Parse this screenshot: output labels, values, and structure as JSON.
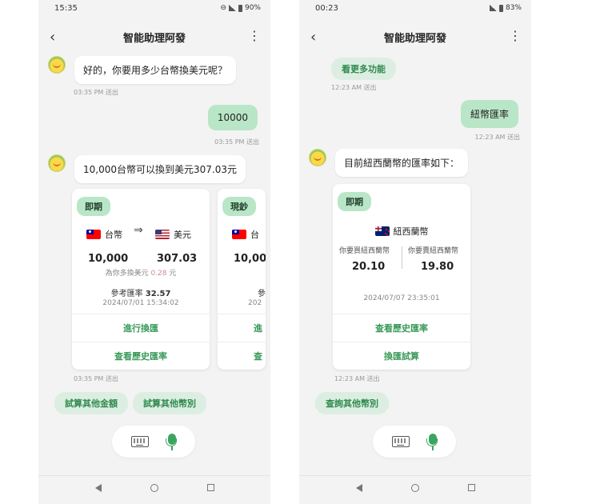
{
  "left": {
    "status": {
      "time": "15:35",
      "battery": "90%"
    },
    "appbar": {
      "title": "智能助理阿發"
    },
    "messages": {
      "bot1": "好的，你要用多少台幣換美元呢？",
      "time1": "03:35 PM 送出",
      "user1": "10000",
      "time2": "03:35 PM 送出",
      "bot2": "10,000台幣可以換到美元307.03元",
      "time3": "03:35 PM 送出"
    },
    "card1": {
      "tag": "即期",
      "from_currency": "台幣",
      "to_currency": "美元",
      "from_amount": "10,000",
      "to_amount": "307.03",
      "extra_prefix": "為你多換美元",
      "extra_value": "0.28",
      "extra_suffix": "元",
      "ref_label": "參考匯率",
      "ref_value": "32.57",
      "timestamp": "2024/07/01 15:34:02",
      "action1": "進行換匯",
      "action2": "查看歷史匯率"
    },
    "card2": {
      "tag": "現鈔",
      "from_currency": "台",
      "from_amount": "10,00",
      "ref_partial": "參",
      "timestamp_partial": "202",
      "action1_partial": "進",
      "action2_partial": "查"
    },
    "chips": [
      "試算其他金額",
      "試算其他幣別"
    ]
  },
  "right": {
    "status": {
      "time": "00:23",
      "battery": "83%"
    },
    "appbar": {
      "title": "智能助理阿發"
    },
    "messages": {
      "chip_top": "看更多功能",
      "time0": "12:23 AM 送出",
      "user1": "紐幣匯率",
      "time1": "12:23 AM 送出",
      "bot1": "目前紐西蘭幣的匯率如下：",
      "time2": "12:23 AM 送出"
    },
    "card": {
      "tag": "即期",
      "currency": "紐西蘭幣",
      "buy_label": "你要買紐西蘭幣",
      "buy_value": "20.10",
      "sell_label": "你要賣紐西蘭幣",
      "sell_value": "19.80",
      "timestamp": "2024/07/07 23:35:01",
      "action1": "查看歷史匯率",
      "action2": "換匯試算"
    },
    "chips": [
      "查詢其他幣別"
    ]
  },
  "icons": {
    "back": "chevron-left-icon",
    "menu": "more-vertical-icon",
    "keyboard": "keyboard-icon",
    "mic": "microphone-icon"
  },
  "colors": {
    "accent_green": "#3a9a5a",
    "user_bubble": "#b9e6c7",
    "chip_bg": "#dceee2"
  }
}
